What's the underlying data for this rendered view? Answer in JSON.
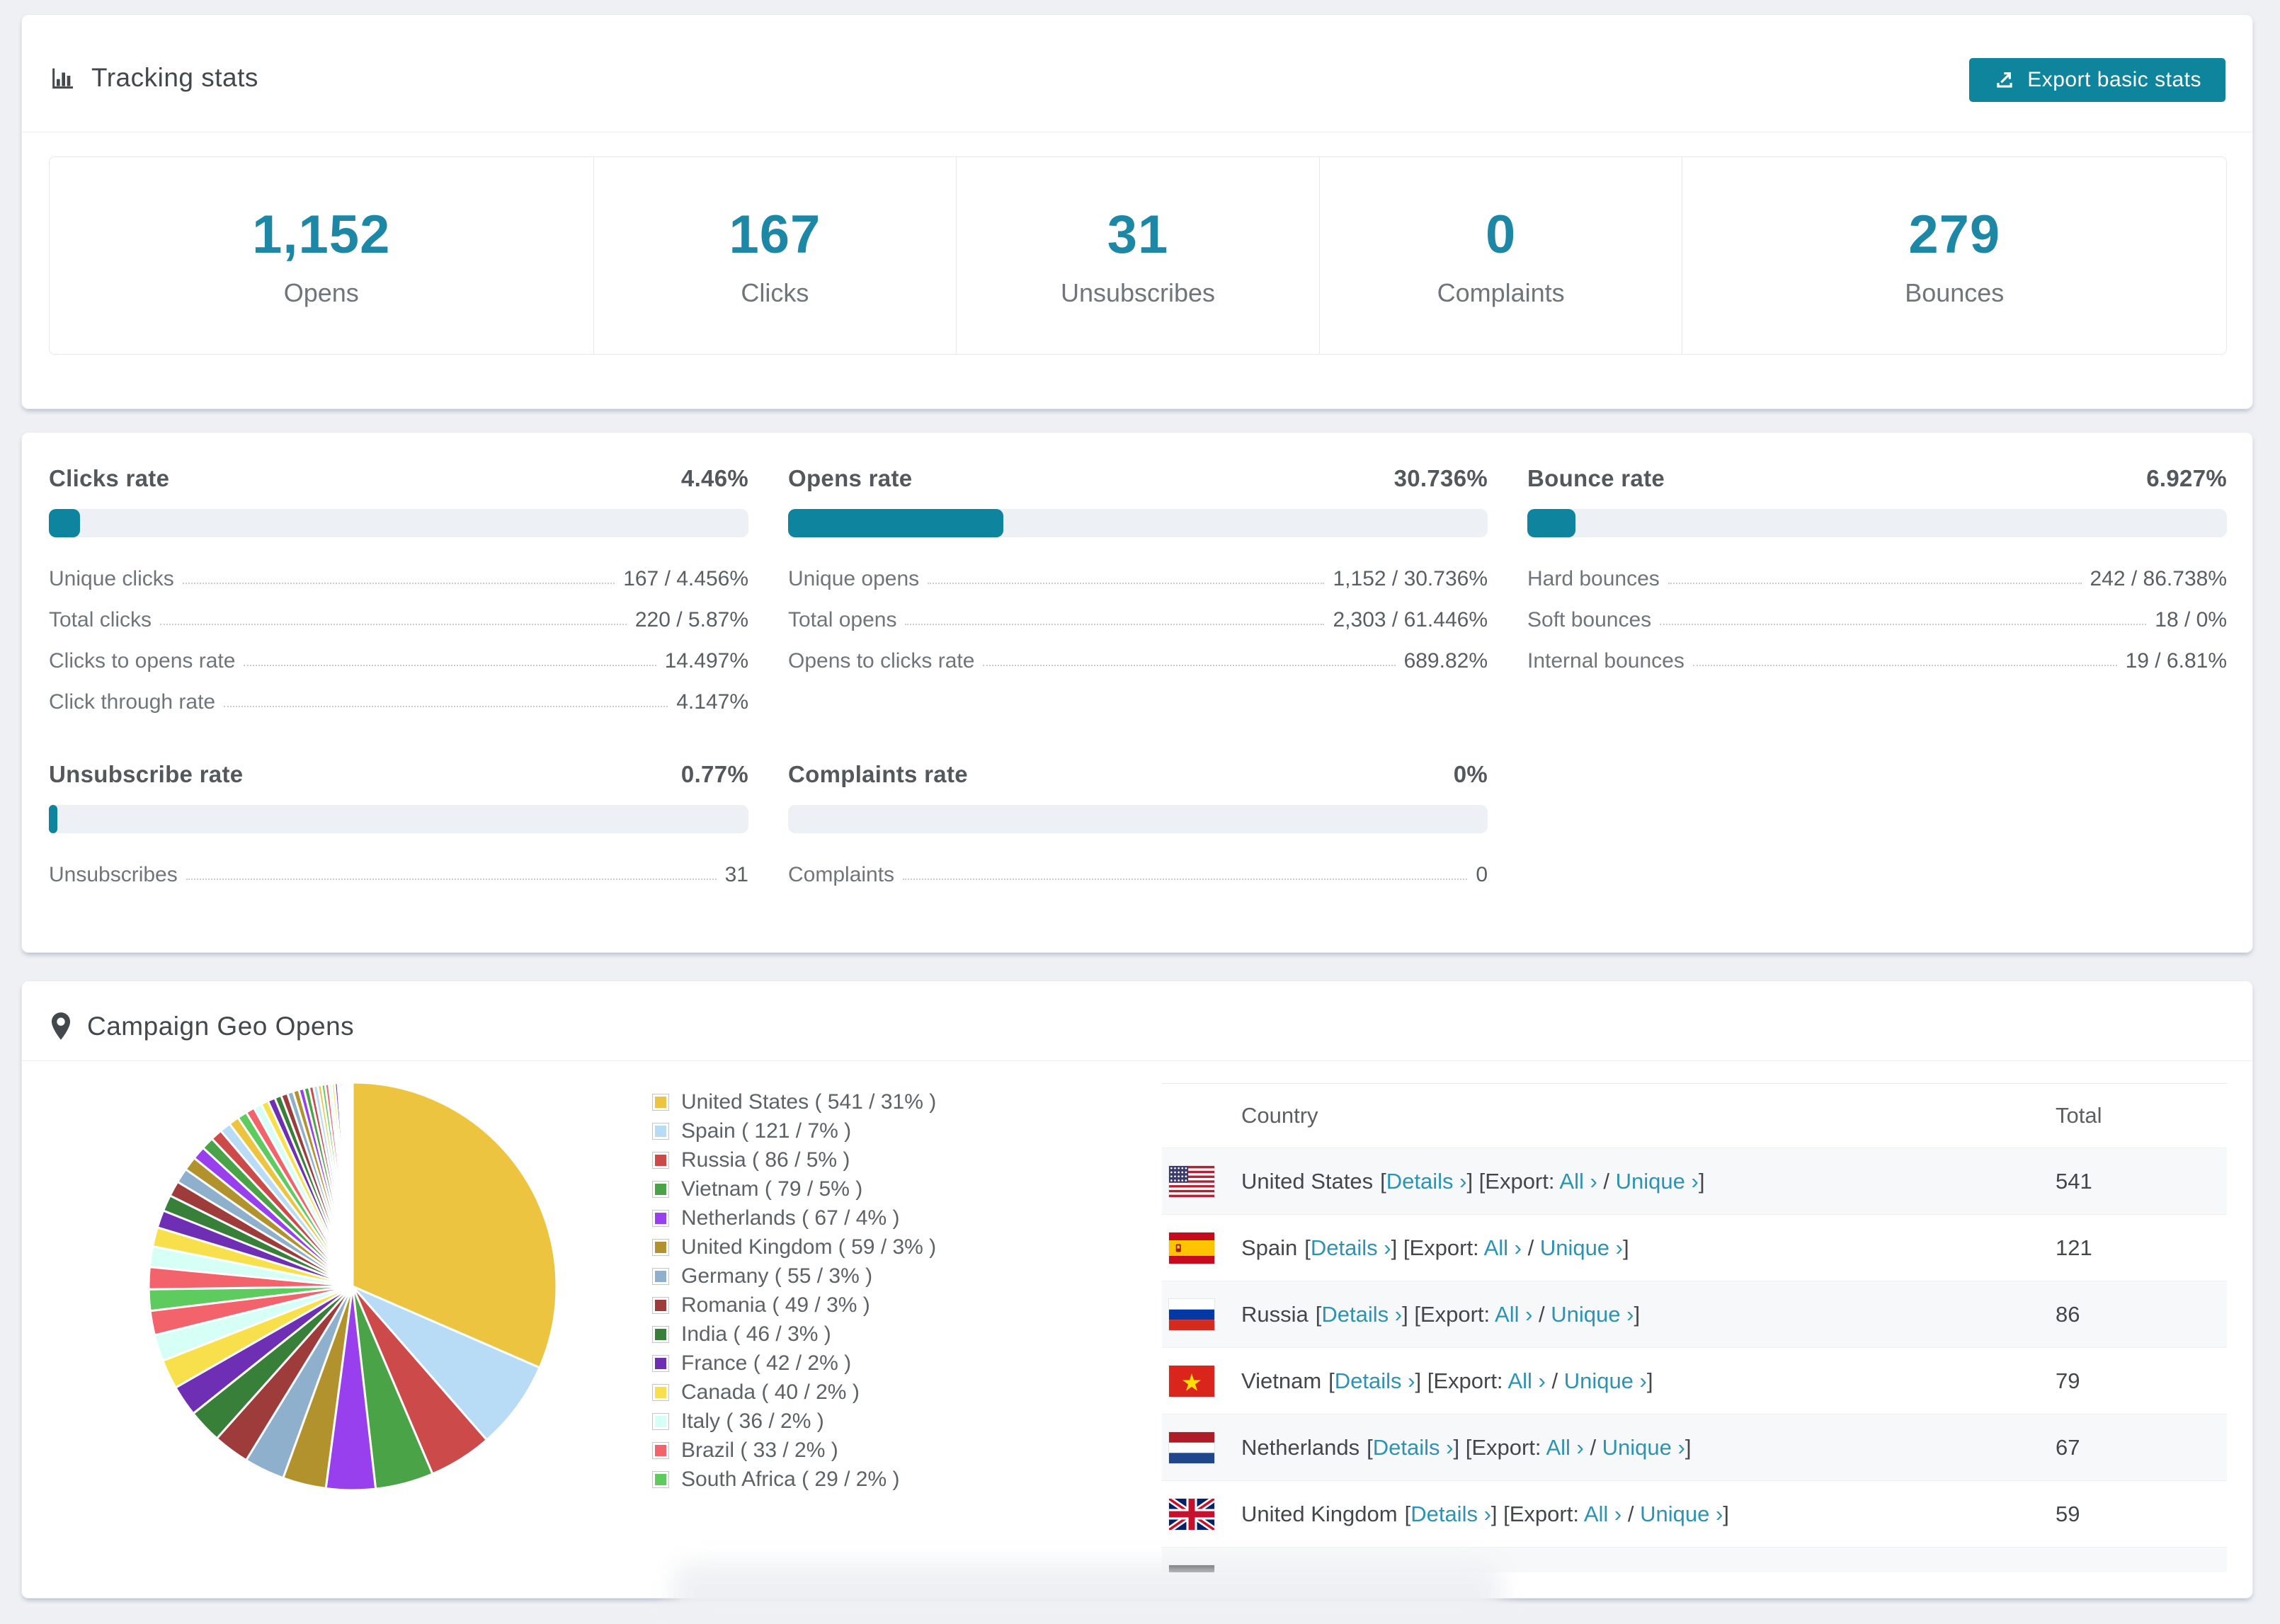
{
  "colors": {
    "accent": "#1d87a6",
    "bar_fill": "#0e849e",
    "button_bg": "#0f849d",
    "link": "#2c93b4"
  },
  "tracking": {
    "title": "Tracking stats",
    "export_button": "Export basic stats",
    "stats": [
      {
        "value": "1,152",
        "label": "Opens"
      },
      {
        "value": "167",
        "label": "Clicks"
      },
      {
        "value": "31",
        "label": "Unsubscribes"
      },
      {
        "value": "0",
        "label": "Complaints"
      },
      {
        "value": "279",
        "label": "Bounces"
      }
    ]
  },
  "rates": [
    {
      "title": "Clicks rate",
      "value": "4.46%",
      "pct": 4.46,
      "rows": [
        {
          "label": "Unique clicks",
          "value": "167 / 4.456%"
        },
        {
          "label": "Total clicks",
          "value": "220 / 5.87%"
        },
        {
          "label": "Clicks to opens rate",
          "value": "14.497%"
        },
        {
          "label": "Click through rate",
          "value": "4.147%"
        }
      ]
    },
    {
      "title": "Opens rate",
      "value": "30.736%",
      "pct": 30.736,
      "rows": [
        {
          "label": "Unique opens",
          "value": "1,152 / 30.736%"
        },
        {
          "label": "Total opens",
          "value": "2,303 / 61.446%"
        },
        {
          "label": "Opens to clicks rate",
          "value": "689.82%"
        }
      ]
    },
    {
      "title": "Bounce rate",
      "value": "6.927%",
      "pct": 6.927,
      "rows": [
        {
          "label": "Hard bounces",
          "value": "242 / 86.738%"
        },
        {
          "label": "Soft bounces",
          "value": "18 / 0%"
        },
        {
          "label": "Internal bounces",
          "value": "19 / 6.81%"
        }
      ]
    },
    {
      "title": "Unsubscribe rate",
      "value": "0.77%",
      "pct": 0.77,
      "rows": [
        {
          "label": "Unsubscribes",
          "value": "31"
        }
      ]
    },
    {
      "title": "Complaints rate",
      "value": "0%",
      "pct": 0,
      "rows": [
        {
          "label": "Complaints",
          "value": "0"
        }
      ]
    }
  ],
  "geo": {
    "title": "Campaign Geo Opens"
  },
  "chart_data": {
    "type": "pie",
    "title": "Campaign Geo Opens",
    "legend_position": "right",
    "slices": [
      {
        "label": "United States",
        "value": 541,
        "pct": 31,
        "color": "#ecc440"
      },
      {
        "label": "Spain",
        "value": 121,
        "pct": 7,
        "color": "#b9dcf6"
      },
      {
        "label": "Russia",
        "value": 86,
        "pct": 5,
        "color": "#cc4a4a"
      },
      {
        "label": "Vietnam",
        "value": 79,
        "pct": 5,
        "color": "#4aa347"
      },
      {
        "label": "Netherlands",
        "value": 67,
        "pct": 4,
        "color": "#9840ee"
      },
      {
        "label": "United Kingdom",
        "value": 59,
        "pct": 3,
        "color": "#b2922c"
      },
      {
        "label": "Germany",
        "value": 55,
        "pct": 3,
        "color": "#8fb0cd"
      },
      {
        "label": "Romania",
        "value": 49,
        "pct": 3,
        "color": "#9e3c3c"
      },
      {
        "label": "India",
        "value": 46,
        "pct": 3,
        "color": "#38803a"
      },
      {
        "label": "France",
        "value": 42,
        "pct": 2,
        "color": "#6f2fb4"
      },
      {
        "label": "Canada",
        "value": 40,
        "pct": 2,
        "color": "#f7e04b"
      },
      {
        "label": "Italy",
        "value": 36,
        "pct": 2,
        "color": "#d6fff5"
      },
      {
        "label": "Brazil",
        "value": 33,
        "pct": 2,
        "color": "#f2636c"
      },
      {
        "label": "South Africa",
        "value": 29,
        "pct": 2,
        "color": "#5ecb5e"
      }
    ],
    "others_estimated": {
      "values": [
        30,
        28,
        26,
        24,
        22,
        21,
        20,
        19,
        18,
        17,
        16,
        15,
        14,
        13,
        12,
        11,
        10,
        10,
        9,
        9,
        8,
        8,
        7,
        7,
        6,
        6,
        5,
        5,
        5,
        4,
        4,
        4,
        3,
        3,
        3,
        3,
        2,
        2,
        2,
        2
      ],
      "palette": [
        "#f2636c",
        "#d6fff5",
        "#f7e04b",
        "#6f2fb4",
        "#38803a",
        "#9e3c3c",
        "#8fb0cd",
        "#b2922c",
        "#9840ee",
        "#4aa347",
        "#cc4a4a",
        "#b9dcf6",
        "#ecc440",
        "#5ecb5e"
      ]
    }
  },
  "geo_table": {
    "headers": [
      "Country",
      "Total"
    ],
    "tokens": {
      "open": "[",
      "details": "Details ›",
      "mid": "] [Export: ",
      "all": "All ›",
      "slash": " / ",
      "unique": "Unique ›",
      "close": "]"
    },
    "rows": [
      {
        "flag": "us",
        "country": "United States",
        "total": "541"
      },
      {
        "flag": "es",
        "country": "Spain",
        "total": "121"
      },
      {
        "flag": "ru",
        "country": "Russia",
        "total": "86"
      },
      {
        "flag": "vn",
        "country": "Vietnam",
        "total": "79"
      },
      {
        "flag": "nl",
        "country": "Netherlands",
        "total": "67"
      },
      {
        "flag": "gb",
        "country": "United Kingdom",
        "total": "59"
      }
    ],
    "partial_row": {
      "flag": "de"
    }
  }
}
